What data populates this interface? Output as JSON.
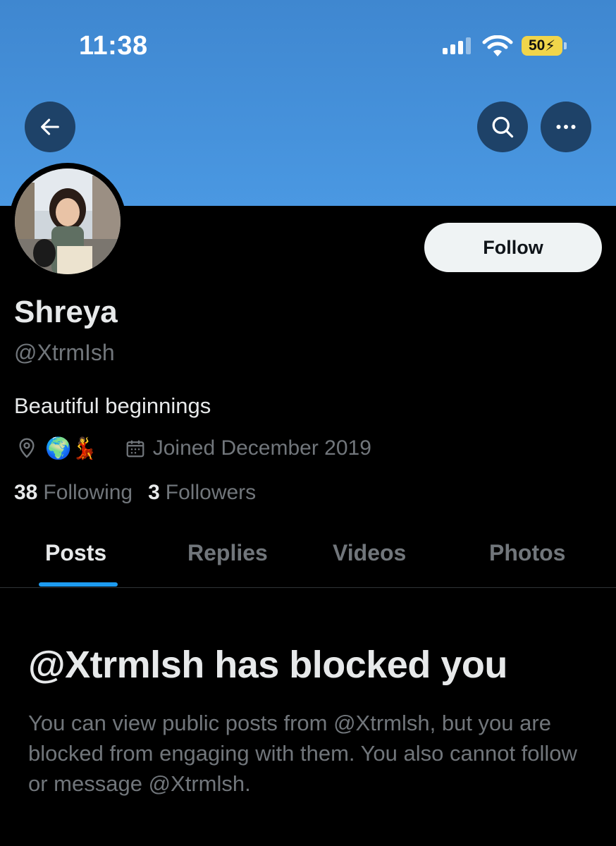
{
  "status_bar": {
    "time": "11:38",
    "battery": "50"
  },
  "header": {
    "back_icon": "arrow-left-icon",
    "search_icon": "search-icon",
    "more_icon": "more-horizontal-icon",
    "banner_color": "#4a98e2"
  },
  "profile": {
    "display_name": "Shreya",
    "handle": "@XtrmIsh",
    "bio": "Beautiful beginnings",
    "location_emojis": "🌍💃",
    "joined": "Joined December 2019",
    "following_count": "38",
    "following_label": "Following",
    "followers_count": "3",
    "followers_label": "Followers",
    "follow_button": "Follow"
  },
  "tabs": [
    {
      "label": "Posts",
      "active": true
    },
    {
      "label": "Replies",
      "active": false
    },
    {
      "label": "Videos",
      "active": false
    },
    {
      "label": "Photos",
      "active": false
    }
  ],
  "blocked_notice": {
    "title": "@Xtrmlsh has blocked you",
    "message": "You can view public posts from @Xtrmlsh, but you are blocked from engaging with them. You also cannot follow or message @Xtrmlsh."
  },
  "colors": {
    "accent": "#1d9bf0",
    "muted_text": "#71767b",
    "primary_text": "#e7e9ea"
  }
}
